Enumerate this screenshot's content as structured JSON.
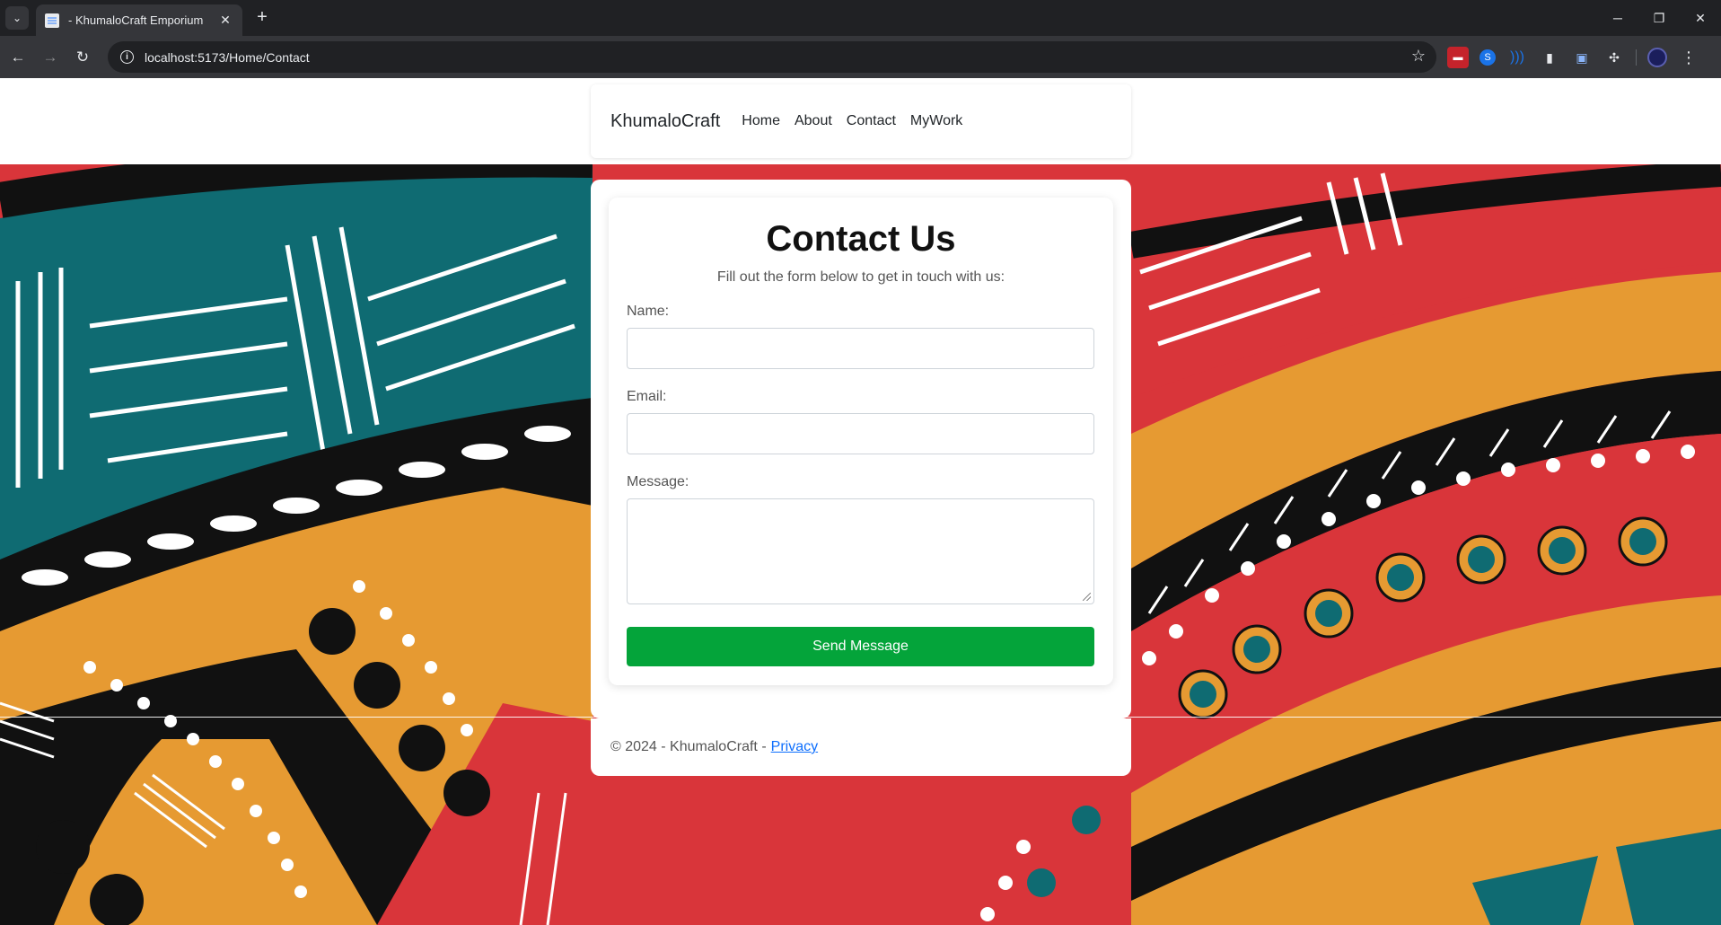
{
  "browser": {
    "tab_title": "- KhumaloCraft Emporium",
    "url": "localhost:5173/Home/Contact",
    "tab_menu_icon": "chevron-down-icon",
    "icons": [
      "back-arrow-icon",
      "forward-arrow-icon",
      "reload-icon",
      "site-info-icon",
      "bookmark-star-icon",
      "extensions-icon",
      "profile-avatar-icon",
      "more-menu-icon"
    ]
  },
  "navbar": {
    "brand": "KhumaloCraft",
    "links": [
      "Home",
      "About",
      "Contact",
      "MyWork"
    ]
  },
  "contact": {
    "title": "Contact Us",
    "subtitle": "Fill out the form below to get in touch with us:",
    "name_label": "Name:",
    "name_value": "",
    "email_label": "Email:",
    "email_value": "",
    "message_label": "Message:",
    "message_value": "",
    "submit_label": "Send Message"
  },
  "footer": {
    "text": "© 2024 - KhumaloCraft -",
    "privacy_link": "Privacy"
  },
  "colors": {
    "button": "#04a43a",
    "link": "#0d6efd",
    "pattern_red": "#d9353a",
    "pattern_teal": "#0f6b72",
    "pattern_orange": "#e69a32",
    "pattern_black": "#111111"
  }
}
